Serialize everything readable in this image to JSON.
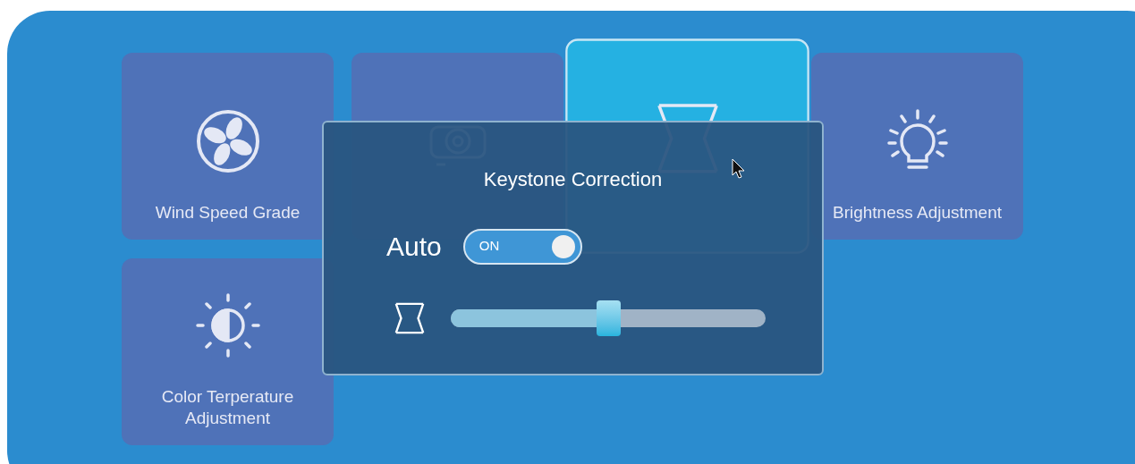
{
  "tiles": [
    {
      "kind": "fan",
      "label": "Wind Speed Grade",
      "selected": false
    },
    {
      "kind": "projector",
      "selected": false
    },
    {
      "kind": "keystone",
      "selected": true
    },
    {
      "kind": "bulb",
      "label": "Brightness Adjustment",
      "selected": false
    },
    {
      "kind": "contrast",
      "label": "Color Terperature Adjustment",
      "selected": false
    }
  ],
  "dialog": {
    "title": "Keystone Correction",
    "auto_label": "Auto",
    "toggle": {
      "on": true,
      "text": "ON"
    },
    "slider": {
      "level": 0.5
    }
  }
}
